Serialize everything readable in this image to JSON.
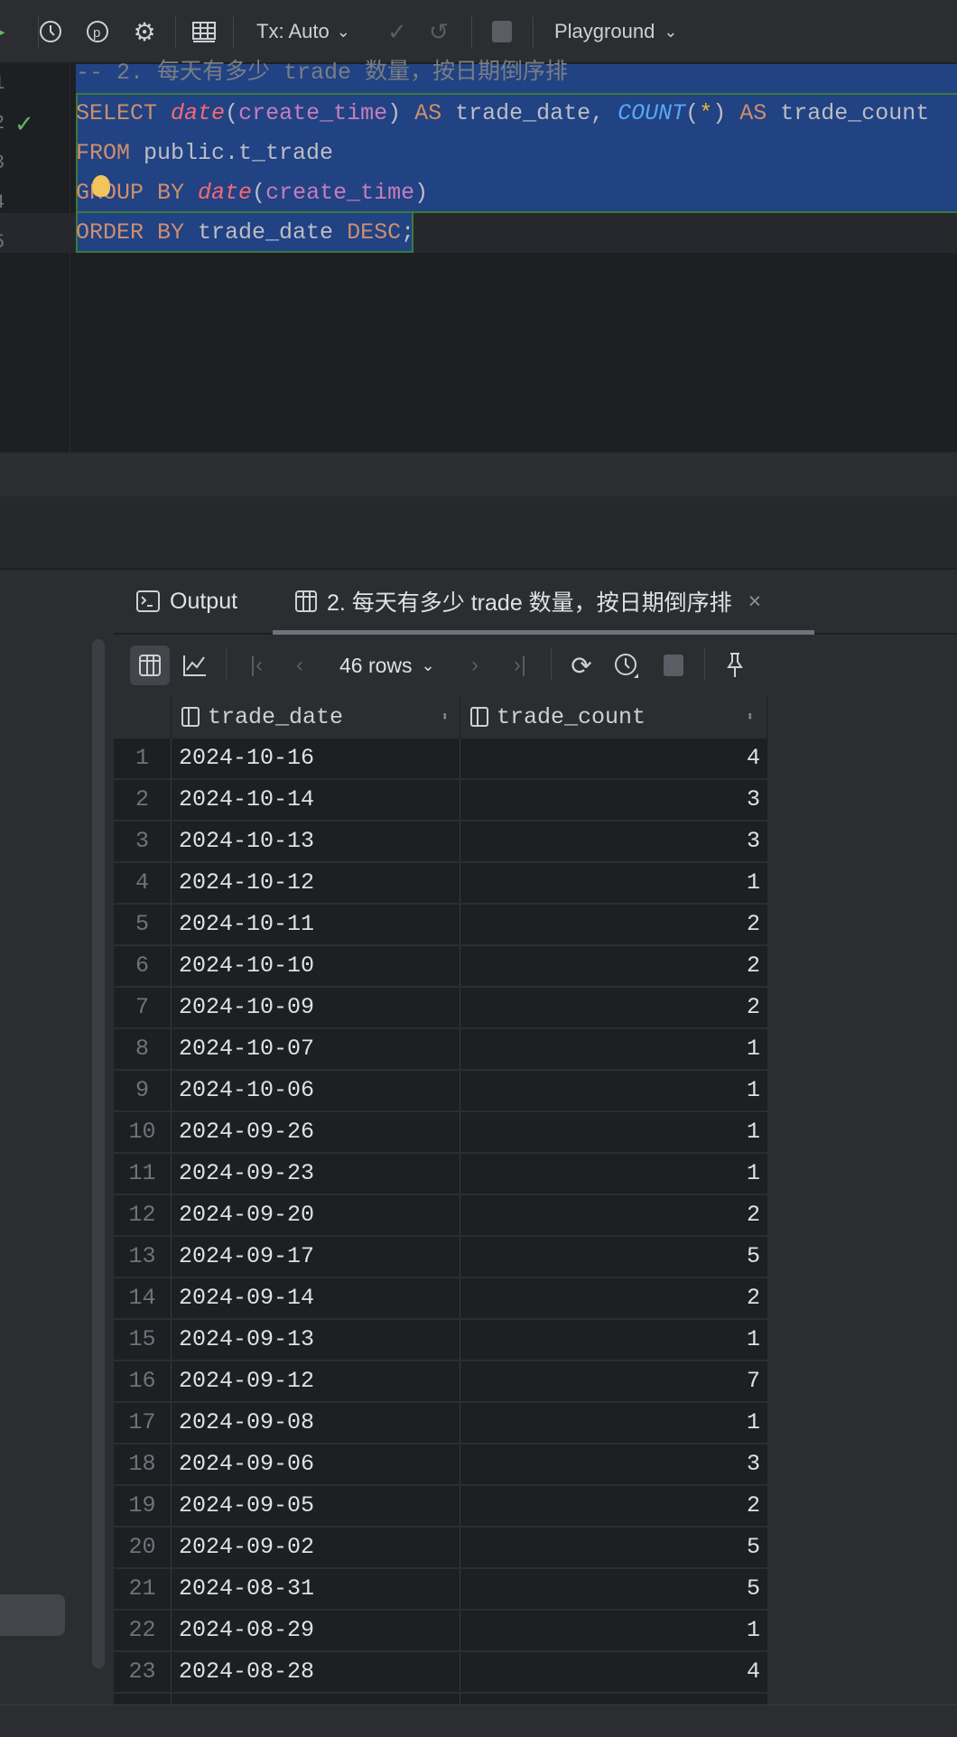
{
  "toolbar": {
    "tx_mode": "Tx: Auto",
    "schema": "Playground"
  },
  "editor": {
    "line_numbers": [
      "1",
      "2",
      "3",
      "4",
      "5"
    ],
    "comment": "-- 2. 每天有多少 trade 数量，按日期倒序排",
    "l2": {
      "select": "SELECT",
      "date": "date",
      "open": "(",
      "arg": "create_time",
      "close": ")",
      "as1": " AS ",
      "alias1": "trade_date, ",
      "count": "COUNT",
      "open2": "(",
      "star": "*",
      "close2": ")",
      "as2": " AS ",
      "alias2": "trade_count"
    },
    "l3": {
      "from": "FROM",
      "table": " public.t_trade"
    },
    "l4": {
      "group": "GROUP BY ",
      "date": "date",
      "open": "(",
      "arg": "create_time",
      "close": ")"
    },
    "l5": {
      "order": "ORDER BY",
      "col": " trade_date ",
      "desc": "DESC",
      "semi": ";"
    }
  },
  "panel": {
    "output_tab": "Output",
    "result_tab": "2. 每天有多少 trade 数量，按日期倒序排",
    "close": "×",
    "rows_label": "46 rows"
  },
  "colors": {
    "selection": "#214283",
    "accent_green": "#5fb865",
    "keyword": "#cf8e6d"
  },
  "grid": {
    "columns": [
      "trade_date",
      "trade_count"
    ],
    "rows": [
      [
        "1",
        "2024-10-16",
        "4"
      ],
      [
        "2",
        "2024-10-14",
        "3"
      ],
      [
        "3",
        "2024-10-13",
        "3"
      ],
      [
        "4",
        "2024-10-12",
        "1"
      ],
      [
        "5",
        "2024-10-11",
        "2"
      ],
      [
        "6",
        "2024-10-10",
        "2"
      ],
      [
        "7",
        "2024-10-09",
        "2"
      ],
      [
        "8",
        "2024-10-07",
        "1"
      ],
      [
        "9",
        "2024-10-06",
        "1"
      ],
      [
        "10",
        "2024-09-26",
        "1"
      ],
      [
        "11",
        "2024-09-23",
        "1"
      ],
      [
        "12",
        "2024-09-20",
        "2"
      ],
      [
        "13",
        "2024-09-17",
        "5"
      ],
      [
        "14",
        "2024-09-14",
        "2"
      ],
      [
        "15",
        "2024-09-13",
        "1"
      ],
      [
        "16",
        "2024-09-12",
        "7"
      ],
      [
        "17",
        "2024-09-08",
        "1"
      ],
      [
        "18",
        "2024-09-06",
        "3"
      ],
      [
        "19",
        "2024-09-05",
        "2"
      ],
      [
        "20",
        "2024-09-02",
        "5"
      ],
      [
        "21",
        "2024-08-31",
        "5"
      ],
      [
        "22",
        "2024-08-29",
        "1"
      ],
      [
        "23",
        "2024-08-28",
        "4"
      ]
    ]
  }
}
